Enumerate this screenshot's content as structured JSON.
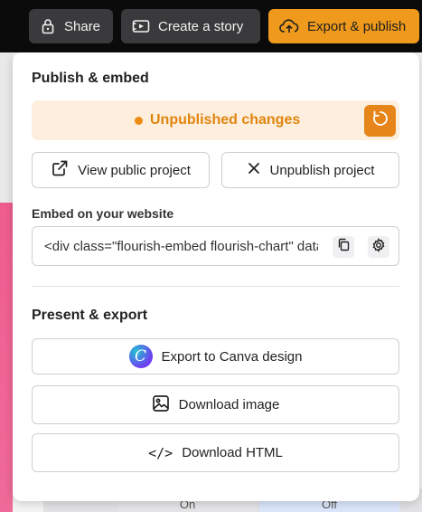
{
  "topbar": {
    "share_label": "Share",
    "story_label": "Create a story",
    "export_label": "Export & publish"
  },
  "background": {
    "on_label": "On",
    "off_label": "Off"
  },
  "panel": {
    "publish_title": "Publish & embed",
    "status_text": "Unpublished changes",
    "view_public_label": "View public project",
    "unpublish_label": "Unpublish project",
    "embed_label": "Embed on your website",
    "embed_code": "<div class=\"flourish-embed flourish-chart\" data-src=\"visualisation/\"></div>",
    "present_title": "Present & export",
    "canva_label": "Export to Canva design",
    "canva_logo_letter": "C",
    "download_image_label": "Download image",
    "download_html_label": "Download HTML",
    "html_icon_glyph": "</>"
  },
  "colors": {
    "accent_orange": "#ef9a1c",
    "status_bg": "#fdeedd",
    "status_text": "#e0850f"
  },
  "icons": [
    "lock-icon",
    "story-icon",
    "cloud-upload-icon",
    "refresh-icon",
    "external-link-icon",
    "close-icon",
    "copy-icon",
    "gear-icon",
    "canva-logo",
    "image-icon",
    "code-icon"
  ]
}
